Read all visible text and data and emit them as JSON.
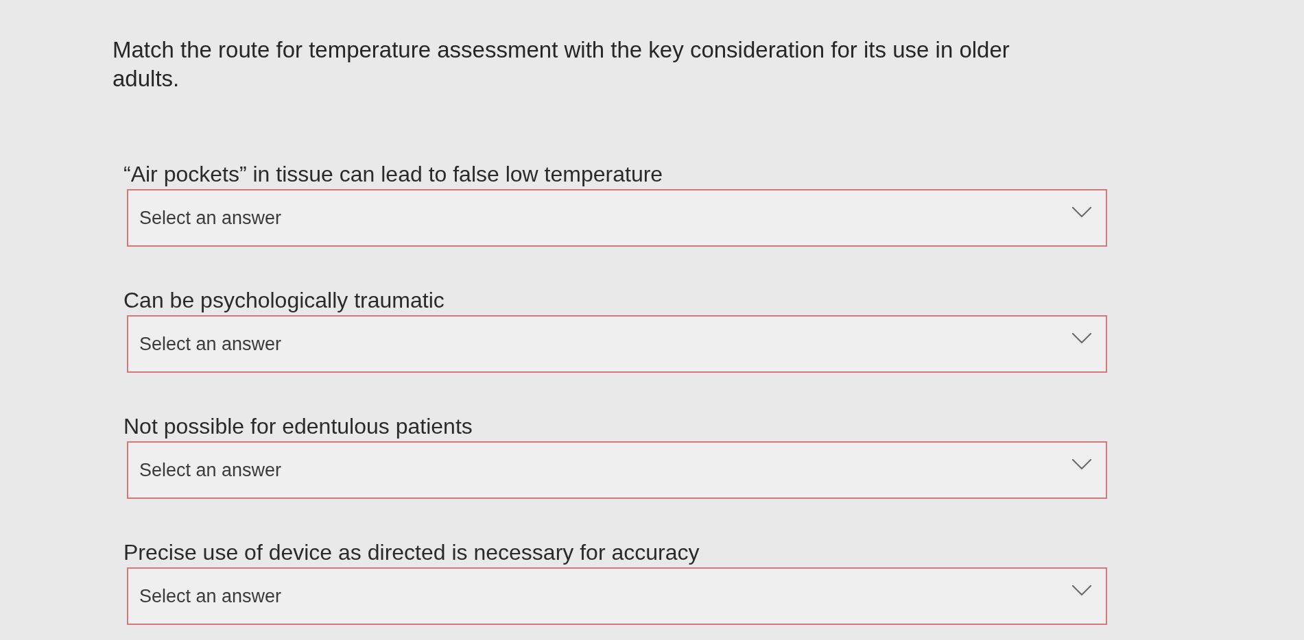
{
  "question": "Match the route for temperature assessment with the key consideration for its use in older adults.",
  "items": [
    {
      "label": "“Air pockets” in tissue can lead to false low temperature",
      "placeholder": "Select an answer"
    },
    {
      "label": "Can be psychologically traumatic",
      "placeholder": "Select an answer"
    },
    {
      "label": "Not possible for edentulous patients",
      "placeholder": "Select an answer"
    },
    {
      "label": "Precise use of device as directed is necessary for accuracy",
      "placeholder": "Select an answer"
    }
  ]
}
